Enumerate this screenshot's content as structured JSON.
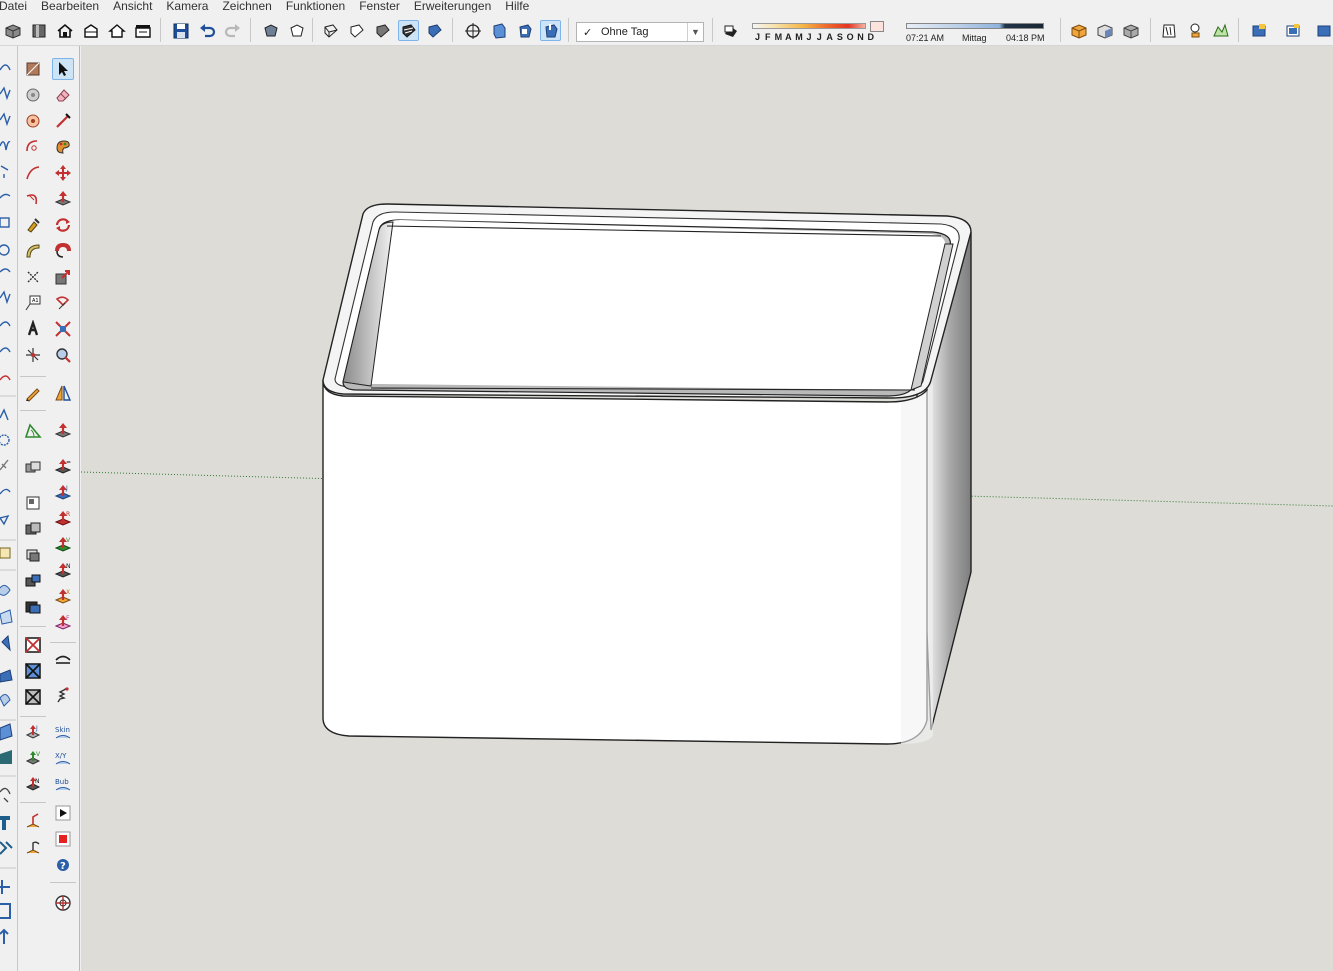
{
  "menu": [
    "Datei",
    "Bearbeiten",
    "Ansicht",
    "Kamera",
    "Zeichnen",
    "Funktionen",
    "Fenster",
    "Erweiterungen",
    "Hilfe"
  ],
  "tag_select": {
    "check": "✓",
    "value": "Ohne Tag"
  },
  "shadow_months": {
    "labels": [
      "J",
      "F",
      "M",
      "A",
      "M",
      "J",
      "J",
      "A",
      "S",
      "O",
      "N",
      "D"
    ]
  },
  "shadow_time": {
    "start": "07:21 AM",
    "middle": "Mittag",
    "end": "04:18 PM"
  },
  "right_toolbar_labels": {
    "skin": "Skin",
    "xy": "X/Y",
    "bub": "Bub"
  },
  "colors": {
    "viewport": "#dddcd7",
    "selection": "#cde4f7",
    "model_face": "#ffffff",
    "model_shade": "#8a8a8a"
  }
}
